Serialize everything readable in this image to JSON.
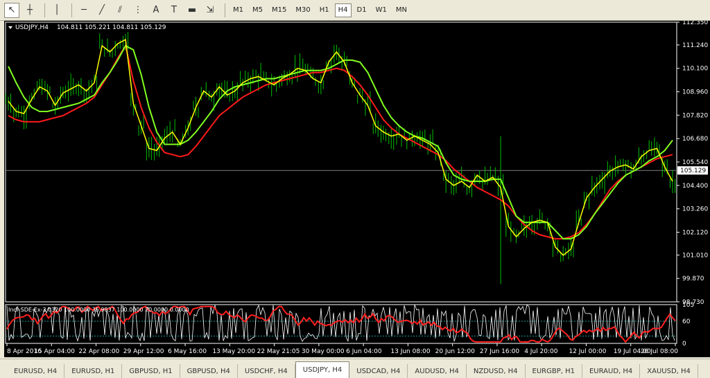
{
  "toolbar": {
    "tools": [
      {
        "name": "cursor-icon",
        "glyph": "↖",
        "active": true
      },
      {
        "name": "crosshair-icon",
        "glyph": "┼",
        "active": false
      },
      {
        "name": "vertical-line-icon",
        "glyph": "│",
        "active": false
      },
      {
        "name": "horizontal-line-icon",
        "glyph": "─",
        "active": false
      },
      {
        "name": "trendline-icon",
        "glyph": "╱",
        "active": false
      },
      {
        "name": "equidistant-channel-icon",
        "glyph": "⫽",
        "active": false
      },
      {
        "name": "fibonacci-icon",
        "glyph": "⋮",
        "active": false
      },
      {
        "name": "text-icon",
        "glyph": "A",
        "active": false
      },
      {
        "name": "text-label-icon",
        "glyph": "T",
        "active": false
      },
      {
        "name": "rectangle-icon",
        "glyph": "▬",
        "active": false
      },
      {
        "name": "arrows-icon",
        "glyph": "⇲",
        "active": false
      }
    ],
    "timeframes": [
      "M1",
      "M5",
      "M15",
      "M30",
      "H1",
      "H4",
      "D1",
      "W1",
      "MN"
    ],
    "active_timeframe": "H4"
  },
  "chart_header": {
    "symbol": "USDJPY,H4",
    "ohlc": "104.811 105.221 104.811 105.129"
  },
  "indicator_header": "Indi-SDE-Ex-3.0320 100.0000 35.9837 100.0000 20.0000 0.0000",
  "current_price": "105.129",
  "colors": {
    "background": "#000000",
    "candles": "#00c000",
    "fast_line": "#ffff00",
    "medium_line": "#80ff20",
    "slow_line": "#ff1a1a",
    "grid": "#808080",
    "indicator_fast": "#ffffff",
    "indicator_slow": "#ff2020"
  },
  "chart_data": {
    "type": "line",
    "y_axis_ticks": [
      "112.350",
      "111.240",
      "110.100",
      "108.960",
      "107.820",
      "106.680",
      "105.540",
      "104.400",
      "103.260",
      "102.120",
      "101.010",
      "99.870",
      "98.730"
    ],
    "ylim": [
      98.73,
      112.35
    ],
    "indicator_ticks": [
      "105",
      "60",
      "0"
    ],
    "x_axis_labels": [
      "8 Apr 2016",
      "15 Apr 04:00",
      "22 Apr 08:00",
      "29 Apr 12:00",
      "6 May 16:00",
      "13 May 20:00",
      "22 May 21:05",
      "30 May 00:00",
      "6 Jun 04:00",
      "13 Jun 08:00",
      "20 Jun 12:00",
      "27 Jun 16:00",
      "4 Jul 20:00",
      "12 Jul 00:00",
      "19 Jul 04:00",
      "26 Jul 08:00"
    ],
    "series": [
      {
        "values": [
          108.5,
          108.0,
          107.9,
          108.6,
          109.2,
          109.0,
          108.3,
          108.9,
          109.1,
          109.3,
          109.0,
          109.4,
          111.2,
          110.9,
          111.3,
          111.5,
          108.4,
          107.3,
          106.2,
          106.1,
          106.7,
          107.0,
          106.4,
          107.2,
          108.2,
          109.0,
          108.7,
          109.2,
          108.8,
          109.0,
          109.4,
          109.6,
          109.7,
          109.5,
          109.3,
          109.6,
          109.8,
          110.1,
          110.0,
          109.6,
          109.4,
          110.4,
          110.9,
          110.4,
          109.4,
          108.8,
          108.3,
          107.3,
          107.0,
          106.8,
          106.9,
          106.6,
          106.8,
          106.6,
          106.4,
          106.0,
          104.7,
          104.4,
          104.6,
          104.3,
          104.9,
          104.6,
          104.8,
          104.3,
          102.4,
          101.9,
          102.3,
          102.6,
          102.7,
          102.6,
          101.4,
          101.0,
          101.3,
          102.6,
          103.8,
          104.3,
          104.7,
          105.1,
          105.3,
          105.4,
          105.2,
          105.8,
          106.1,
          106.2,
          105.3,
          104.6
        ]
      },
      {
        "values": [
          110.2,
          109.4,
          108.7,
          108.2,
          108.0,
          108.0,
          108.1,
          108.2,
          108.3,
          108.4,
          108.6,
          108.8,
          109.4,
          109.9,
          110.5,
          111.2,
          111.0,
          109.8,
          108.2,
          107.0,
          106.4,
          106.4,
          106.4,
          106.6,
          107.0,
          107.5,
          108.0,
          108.6,
          109.0,
          109.2,
          109.3,
          109.4,
          109.5,
          109.6,
          109.6,
          109.7,
          109.8,
          109.9,
          110.0,
          110.0,
          110.0,
          110.1,
          110.3,
          110.5,
          110.5,
          110.4,
          109.9,
          109.1,
          108.3,
          107.7,
          107.3,
          107.0,
          106.8,
          106.7,
          106.5,
          106.3,
          105.5,
          104.9,
          104.7,
          104.6,
          104.6,
          104.6,
          104.7,
          104.7,
          103.8,
          102.9,
          102.6,
          102.6,
          102.6,
          102.6,
          102.2,
          101.8,
          101.8,
          102.0,
          102.4,
          103.0,
          103.5,
          104.0,
          104.5,
          104.9,
          105.1,
          105.3,
          105.6,
          105.8,
          106.1,
          106.6
        ]
      },
      {
        "values": [
          107.8,
          107.6,
          107.5,
          107.5,
          107.5,
          107.6,
          107.7,
          107.8,
          108.0,
          108.2,
          108.4,
          108.7,
          109.3,
          109.9,
          110.6,
          111.2,
          109.5,
          108.2,
          107.2,
          106.5,
          106.0,
          105.9,
          105.8,
          105.9,
          106.3,
          106.8,
          107.3,
          107.8,
          108.1,
          108.4,
          108.7,
          108.9,
          109.1,
          109.3,
          109.4,
          109.5,
          109.6,
          109.7,
          109.8,
          109.9,
          109.9,
          110.0,
          110.1,
          110.0,
          109.7,
          109.3,
          108.8,
          108.2,
          107.6,
          107.2,
          106.9,
          106.7,
          106.5,
          106.3,
          106.1,
          105.9,
          105.6,
          105.2,
          104.9,
          104.6,
          104.3,
          104.1,
          103.9,
          103.7,
          103.4,
          102.9,
          102.5,
          102.2,
          102.0,
          101.9,
          101.8,
          101.8,
          101.9,
          102.1,
          102.5,
          103.0,
          103.6,
          104.2,
          104.6,
          104.9,
          105.1,
          105.3,
          105.5,
          105.7,
          105.8,
          105.9
        ]
      }
    ]
  },
  "tabs": [
    "EURUSD, H4",
    "EURUSD, H1",
    "GBPUSD, H1",
    "GBPUSD, H4",
    "USDCHF, H4",
    "USDJPY, H4",
    "USDCAD, H4",
    "AUDUSD, H4",
    "NZDUSD, H4",
    "EURGBP, H1",
    "EURAUD, H4",
    "XAUUSD, H4"
  ],
  "active_tab": "USDJPY, H4"
}
